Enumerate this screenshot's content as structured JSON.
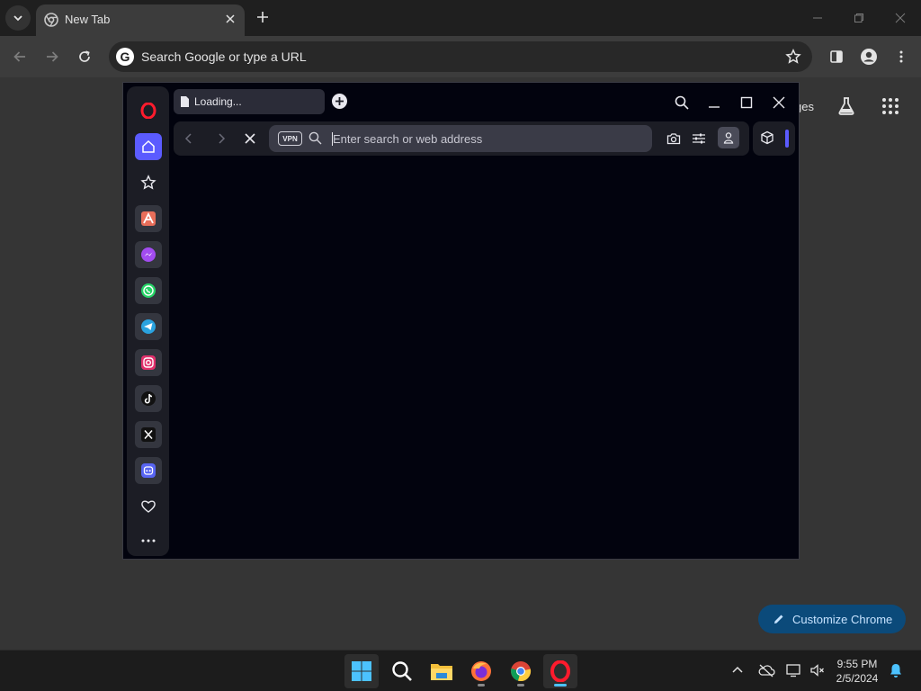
{
  "chrome": {
    "tab": {
      "title": "New Tab"
    },
    "omnibox": {
      "placeholder": "Search Google or type a URL",
      "logo_letter": "G"
    },
    "ntp": {
      "images_partial": "ges",
      "customize_label": "Customize Chrome"
    }
  },
  "opera": {
    "tab": {
      "title": "Loading..."
    },
    "address": {
      "placeholder": "Enter search or web address",
      "vpn_label": "VPN"
    },
    "sidebar": {
      "items": [
        {
          "name": "opera-logo-icon"
        },
        {
          "name": "home-icon"
        },
        {
          "name": "speed-dial-icon"
        },
        {
          "name": "aria-icon"
        },
        {
          "name": "messenger-icon"
        },
        {
          "name": "whatsapp-icon"
        },
        {
          "name": "telegram-icon"
        },
        {
          "name": "instagram-icon"
        },
        {
          "name": "tiktok-icon"
        },
        {
          "name": "x-icon"
        },
        {
          "name": "discord-icon"
        },
        {
          "name": "heart-icon"
        },
        {
          "name": "more-icon"
        }
      ]
    },
    "accent_color": "#5b5bff"
  },
  "taskbar": {
    "apps": [
      {
        "name": "windows-start-icon"
      },
      {
        "name": "search-icon"
      },
      {
        "name": "file-explorer-icon"
      },
      {
        "name": "firefox-icon"
      },
      {
        "name": "chrome-icon"
      },
      {
        "name": "opera-icon"
      }
    ],
    "clock": {
      "time": "9:55 PM",
      "date": "2/5/2024"
    }
  }
}
